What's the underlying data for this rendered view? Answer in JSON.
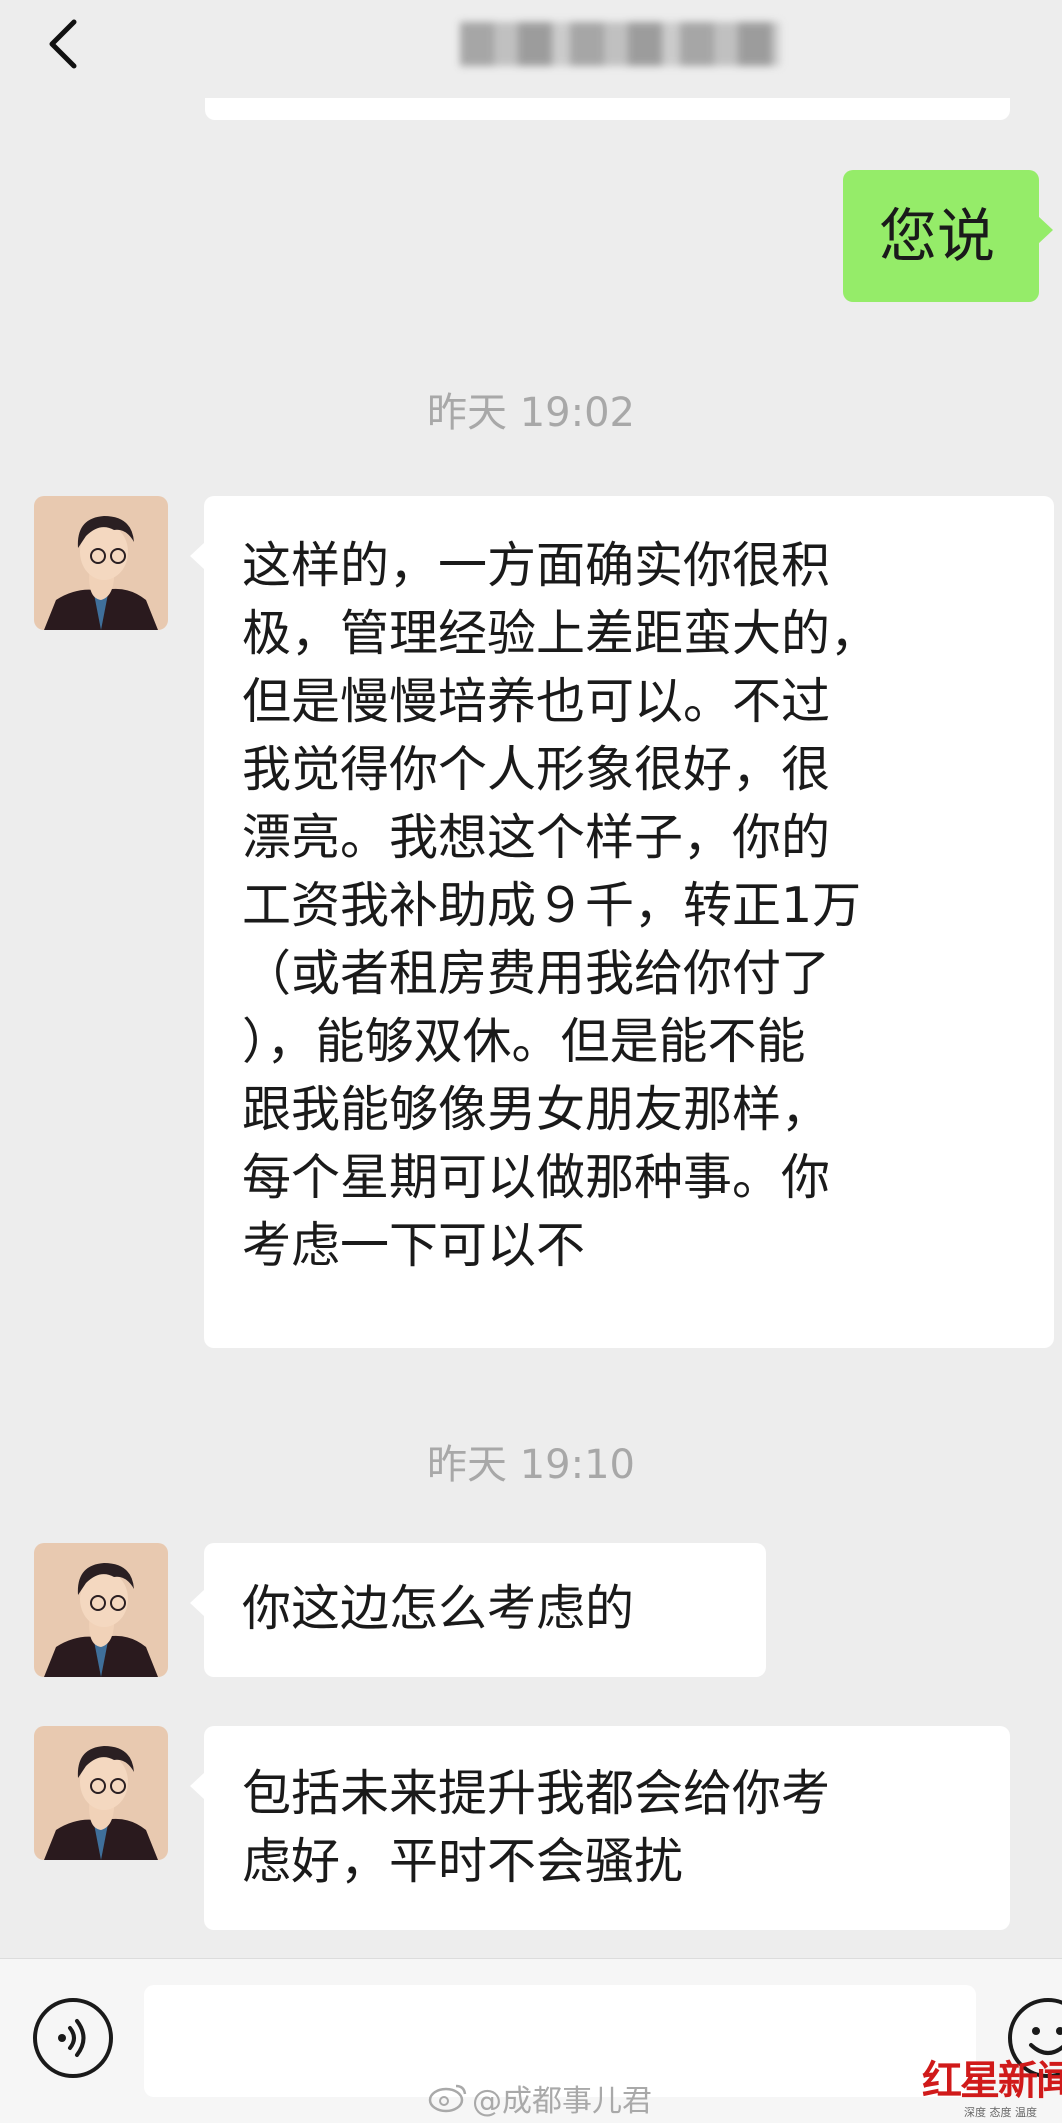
{
  "header": {
    "back_icon": "chevron-left-icon",
    "title": ""
  },
  "messages": [
    {
      "side": "right",
      "text": "您说"
    },
    {
      "type": "time",
      "text": "昨天 19:02"
    },
    {
      "side": "left",
      "lines": [
        "这样的，一方面确实你很积",
        "极，管理经验上差距蛮大的，",
        "但是慢慢培养也可以。不过",
        "我觉得你个人形象很好，很",
        "漂亮。我想这个样子，你的",
        "工资我补助成９千，转正1万",
        "（或者租房费用我给你付了",
        "），能够双休。但是能不能",
        "跟我能够像男女朋友那样，",
        "每个星期可以做那种事。你",
        "考虑一下可以不"
      ]
    },
    {
      "type": "time",
      "text": "昨天 19:10"
    },
    {
      "side": "left",
      "text": "你这边怎么考虑的"
    },
    {
      "side": "left",
      "lines": [
        "包括未来提升我都会给你考",
        "虑好，平时不会骚扰"
      ]
    }
  ],
  "input_bar": {
    "voice_icon": "voice-icon",
    "input_value": "",
    "emoji_icon": "emoji-icon"
  },
  "watermark": {
    "text": "@成都事儿君",
    "logo_text": "红星新闻",
    "logo_sub": "深度 态度 温度"
  },
  "colors": {
    "background": "#ededed",
    "bubble_sent": "#95ec69",
    "bubble_received": "#ffffff",
    "time_text": "#a8a8a8",
    "logo_red": "#d01a1a"
  }
}
